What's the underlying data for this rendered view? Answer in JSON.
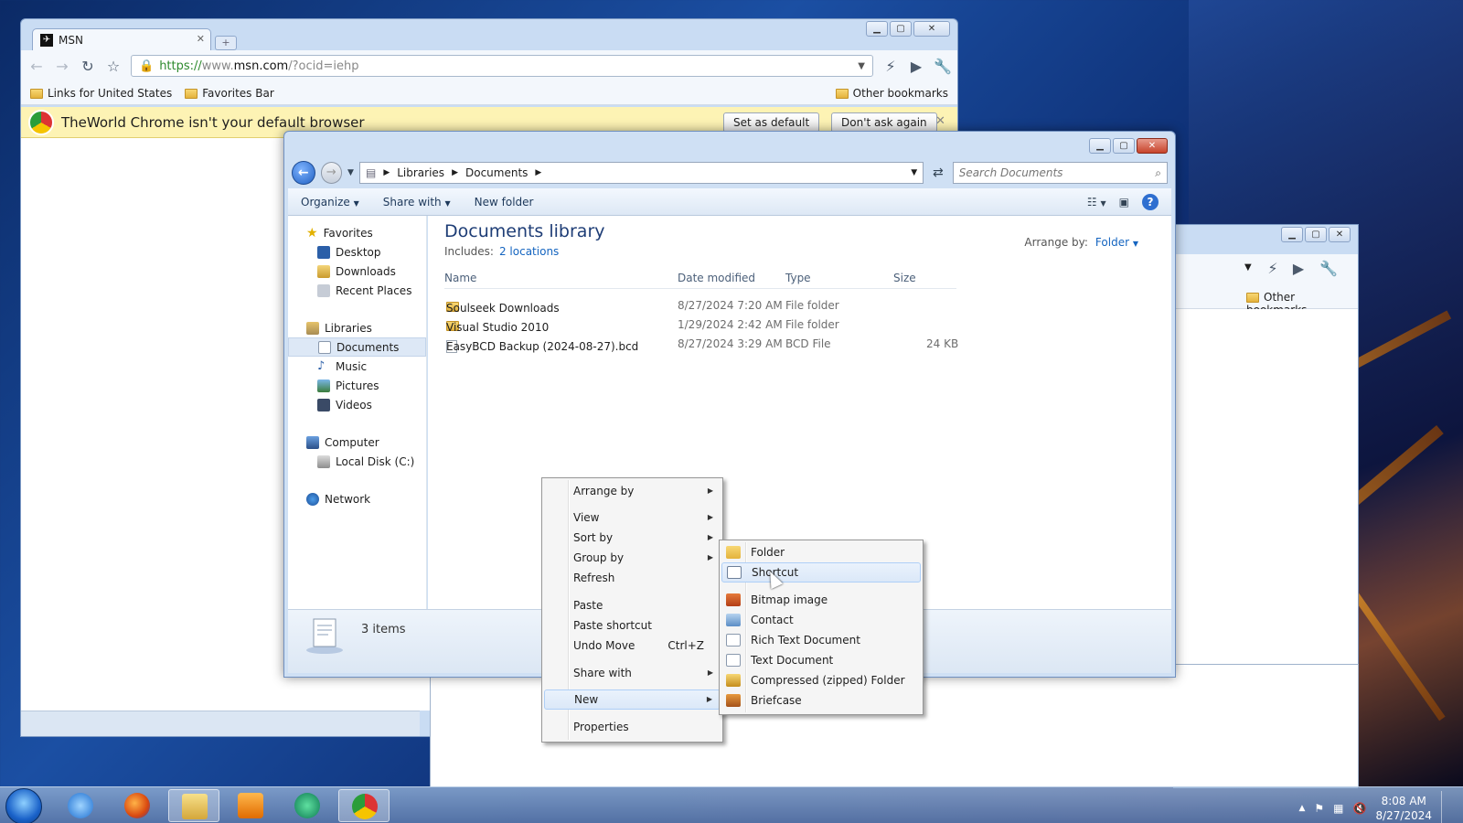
{
  "browser": {
    "tab_title": "MSN",
    "url_https": "https://",
    "url_www": "www.",
    "url_host": "msn.com",
    "url_path": "/?ocid=iehp",
    "bookmarks": [
      "Links for United States",
      "Favorites Bar"
    ],
    "other_bookmarks": "Other bookmarks",
    "infobar_text": "TheWorld Chrome isn't your default browser",
    "set_default": "Set as default",
    "dont_ask": "Don't ask again"
  },
  "explorer": {
    "breadcrumb": [
      "Libraries",
      "Documents"
    ],
    "search_placeholder": "Search Documents",
    "commands": {
      "organize": "Organize",
      "share_with": "Share with",
      "new_folder": "New folder"
    },
    "nav": {
      "favorites": "Favorites",
      "favorites_items": [
        "Desktop",
        "Downloads",
        "Recent Places"
      ],
      "libraries": "Libraries",
      "libraries_items": [
        "Documents",
        "Music",
        "Pictures",
        "Videos"
      ],
      "computer": "Computer",
      "computer_items": [
        "Local Disk (C:)"
      ],
      "network": "Network"
    },
    "library_title": "Documents library",
    "includes_label": "Includes:",
    "includes_link": "2 locations",
    "arrange_label": "Arrange by:",
    "arrange_value": "Folder",
    "columns": {
      "name": "Name",
      "date": "Date modified",
      "type": "Type",
      "size": "Size"
    },
    "files": [
      {
        "name": "Soulseek Downloads",
        "date": "8/27/2024 7:20 AM",
        "type": "File folder",
        "size": ""
      },
      {
        "name": "Visual Studio 2010",
        "date": "1/29/2024 2:42 AM",
        "type": "File folder",
        "size": ""
      },
      {
        "name": "EasyBCD Backup (2024-08-27).bcd",
        "date": "8/27/2024 3:29 AM",
        "type": "BCD File",
        "size": "24 KB"
      }
    ],
    "status_count": "3 items"
  },
  "context_menu": {
    "arrange_by": "Arrange by",
    "view": "View",
    "sort_by": "Sort by",
    "group_by": "Group by",
    "refresh": "Refresh",
    "paste": "Paste",
    "paste_shortcut": "Paste shortcut",
    "undo_move": "Undo Move",
    "undo_shortcut": "Ctrl+Z",
    "share_with": "Share with",
    "new": "New",
    "properties": "Properties"
  },
  "submenu": {
    "folder": "Folder",
    "shortcut": "Shortcut",
    "bitmap": "Bitmap image",
    "contact": "Contact",
    "rtf": "Rich Text Document",
    "text": "Text Document",
    "zip": "Compressed (zipped) Folder",
    "briefcase": "Briefcase"
  },
  "taskbar": {
    "time": "8:08 AM",
    "date": "8/27/2024"
  },
  "colors": {
    "accent": "#1565c0",
    "title": "#1e3d76",
    "infobar": "#fdf3b4"
  }
}
